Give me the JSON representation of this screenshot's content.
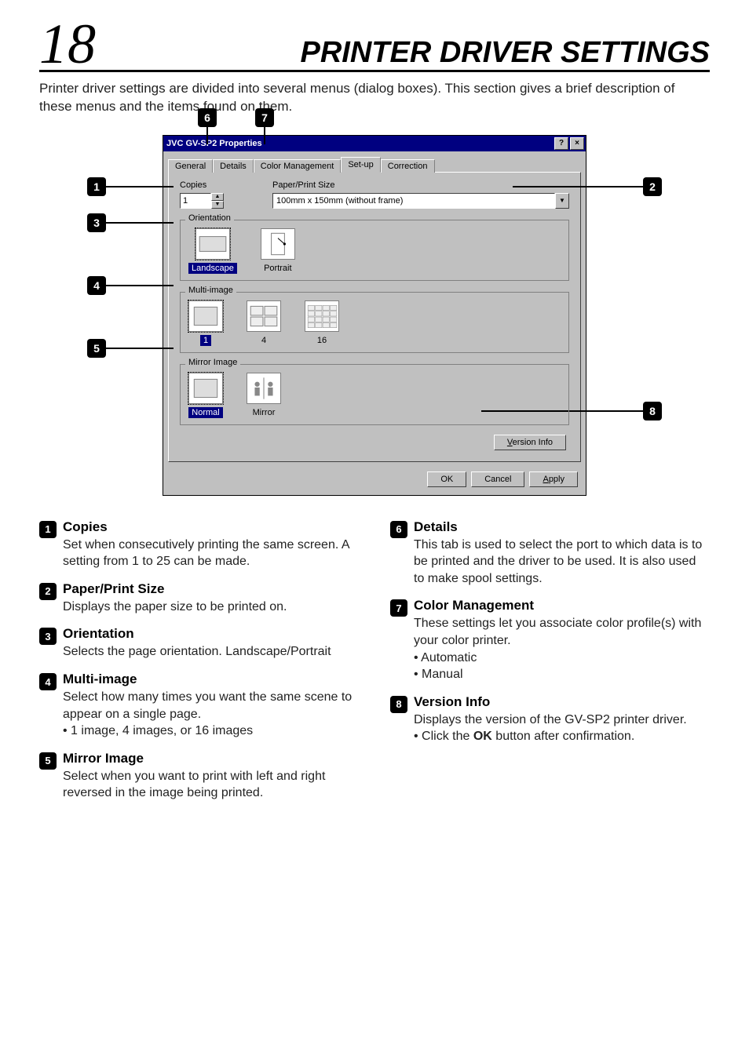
{
  "page_number": "18",
  "title": "PRINTER DRIVER SETTINGS",
  "intro": "Printer driver settings are divided into several menus (dialog boxes). This section gives a brief description of these menus and the items found on them.",
  "dialog": {
    "title": "JVC GV-SP2 Properties",
    "help_btn": "?",
    "close_btn": "×",
    "tabs": [
      "General",
      "Details",
      "Color Management",
      "Set-up",
      "Correction"
    ],
    "active_tab": "Set-up",
    "copies_label": "Copies",
    "copies_value": "1",
    "pps_label": "Paper/Print Size",
    "pps_value": "100mm x 150mm (without frame)",
    "orientation_label": "Orientation",
    "orientation_opts": [
      {
        "label": "Landscape",
        "selected": true
      },
      {
        "label": "Portrait",
        "selected": false
      }
    ],
    "multi_label": "Multi-image",
    "multi_opts": [
      {
        "label": "1",
        "selected": true
      },
      {
        "label": "4",
        "selected": false
      },
      {
        "label": "16",
        "selected": false
      }
    ],
    "mirror_label": "Mirror Image",
    "mirror_opts": [
      {
        "label": "Normal",
        "selected": true
      },
      {
        "label": "Mirror",
        "selected": false
      }
    ],
    "version_btn": "Version Info",
    "ok_btn": "OK",
    "cancel_btn": "Cancel",
    "apply_btn": "Apply"
  },
  "callouts": {
    "c1": "1",
    "c2": "2",
    "c3": "3",
    "c4": "4",
    "c5": "5",
    "c6": "6",
    "c7": "7",
    "c8": "8"
  },
  "items_left": [
    {
      "n": "1",
      "h": "Copies",
      "d": "Set when consecutively printing the same screen. A setting from 1 to 25 can be made."
    },
    {
      "n": "2",
      "h": "Paper/Print Size",
      "d": "Displays the paper size to be printed on."
    },
    {
      "n": "3",
      "h": "Orientation",
      "d": "Selects the page orientation. Landscape/Portrait"
    },
    {
      "n": "4",
      "h": "Multi-image",
      "d": "Select how many times you want the same scene to appear on a single page.",
      "d2": "• 1 image, 4 images, or 16 images"
    },
    {
      "n": "5",
      "h": "Mirror Image",
      "d": "Select when you want to print with left and right reversed in the image being printed."
    }
  ],
  "items_right": [
    {
      "n": "6",
      "h": "Details",
      "d": "This tab is used to select the port to which data is to be printed and the driver to be used. It is also used to make spool settings."
    },
    {
      "n": "7",
      "h": "Color Management",
      "d": "These settings let you associate color profile(s) with your color printer.",
      "bullets": [
        "Automatic",
        "Manual"
      ]
    },
    {
      "n": "8",
      "h": "Version Info",
      "d": "Displays the version of the GV-SP2 printer driver.",
      "d2html": "• Click the <b>OK</b> button after confirmation."
    }
  ]
}
